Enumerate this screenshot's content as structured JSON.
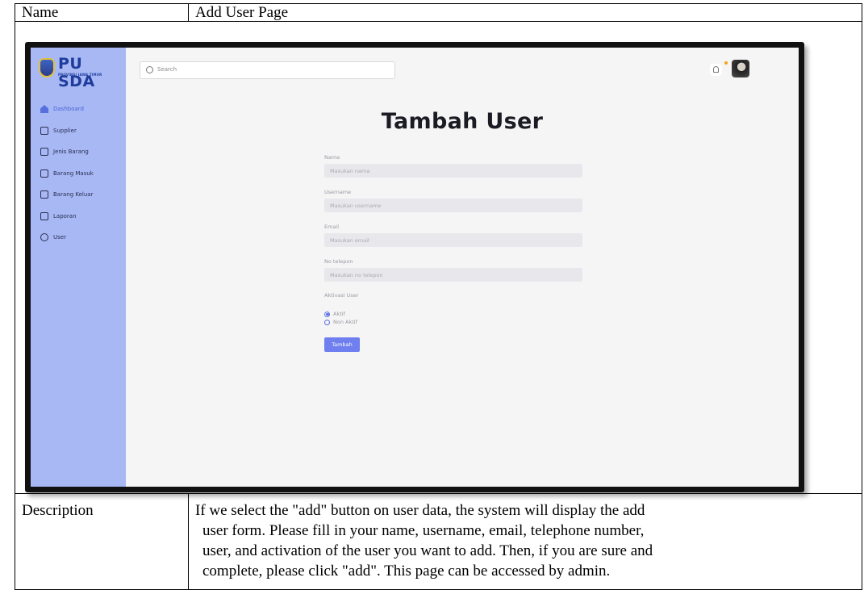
{
  "doc": {
    "name_label": "Name",
    "name_value": "Add User Page",
    "description_label": "Description",
    "description_lines": [
      "If we select the \"add\" button on user data, the system will display the add",
      "user form. Please fill in your name, username, email, telephone number,",
      "user, and activation of the user you want to add. Then, if you are sure and",
      "complete, please click \"add\". This page can be accessed by admin."
    ]
  },
  "app": {
    "logo": {
      "text": "PU SDA",
      "subtitle": "PROVINSI JAWA TIMUR"
    },
    "search": {
      "placeholder": "Search"
    },
    "sidebar": {
      "items": [
        {
          "label": "Dashboard",
          "icon": "home-icon",
          "active": true
        },
        {
          "label": "Supplier",
          "icon": "supplier-icon"
        },
        {
          "label": "Jenis Barang",
          "icon": "box-icon"
        },
        {
          "label": "Barang Masuk",
          "icon": "inbox-icon"
        },
        {
          "label": "Barang Keluar",
          "icon": "outbox-icon"
        },
        {
          "label": "Laporan",
          "icon": "report-icon"
        },
        {
          "label": "User",
          "icon": "gear-icon"
        }
      ]
    },
    "form": {
      "title": "Tambah User",
      "fields": [
        {
          "label": "Nama",
          "placeholder": "Masukan nama"
        },
        {
          "label": "Username",
          "placeholder": "Masukan username"
        },
        {
          "label": "Email",
          "placeholder": "Masukan email"
        },
        {
          "label": "No telepon",
          "placeholder": "Masukan no telepon"
        }
      ],
      "activation_label": "Aktivasi User",
      "options": [
        {
          "label": "Aktif",
          "selected": true
        },
        {
          "label": "Non Aktif",
          "selected": false
        }
      ],
      "submit_label": "Tambah"
    },
    "colors": {
      "sidebar": "#a8b8f4",
      "accent": "#6f7ff0",
      "notification": "#f3a21b"
    }
  }
}
